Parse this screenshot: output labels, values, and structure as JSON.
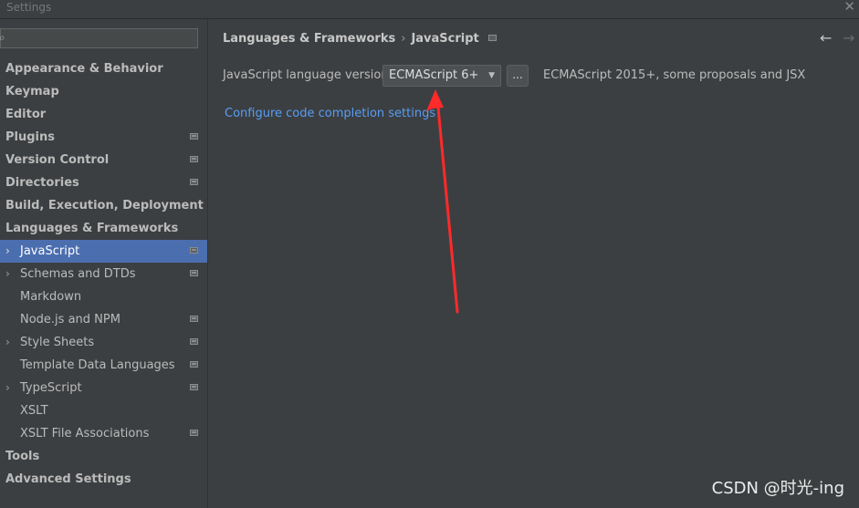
{
  "window": {
    "title": "Settings",
    "close_icon": "close-icon"
  },
  "sidebar": {
    "search_placeholder": "",
    "items": [
      {
        "label": "Appearance & Behavior",
        "bold": true
      },
      {
        "label": "Keymap",
        "bold": true
      },
      {
        "label": "Editor",
        "bold": true
      },
      {
        "label": "Plugins",
        "bold": true,
        "icon": true
      },
      {
        "label": "Version Control",
        "bold": true,
        "icon": true
      },
      {
        "label": "Directories",
        "bold": true,
        "icon": true
      },
      {
        "label": "Build, Execution, Deployment",
        "bold": true
      },
      {
        "label": "Languages & Frameworks",
        "bold": true
      },
      {
        "label": "JavaScript",
        "chevron": true,
        "icon": true,
        "selected": true
      },
      {
        "label": "Schemas and DTDs",
        "chevron": true,
        "icon": true
      },
      {
        "label": "Markdown"
      },
      {
        "label": "Node.js and NPM",
        "icon": true
      },
      {
        "label": "Style Sheets",
        "chevron": true,
        "icon": true
      },
      {
        "label": "Template Data Languages",
        "icon": true
      },
      {
        "label": "TypeScript",
        "chevron": true,
        "icon": true
      },
      {
        "label": "XSLT"
      },
      {
        "label": "XSLT File Associations",
        "icon": true
      },
      {
        "label": "Tools",
        "bold": true
      },
      {
        "label": "Advanced Settings",
        "bold": true
      }
    ]
  },
  "content": {
    "breadcrumb": {
      "parent": "Languages & Frameworks",
      "separator": "›",
      "current": "JavaScript"
    },
    "lang_version_label": "JavaScript language version",
    "lang_version_value": "ECMAScript 6+",
    "more_button": "...",
    "lang_version_desc": "ECMAScript 2015+, some proposals and JSX",
    "completion_link": "Configure code completion settings"
  },
  "annotation": {
    "color": "#ff2a2a"
  },
  "watermark": "CSDN @时光-ing"
}
